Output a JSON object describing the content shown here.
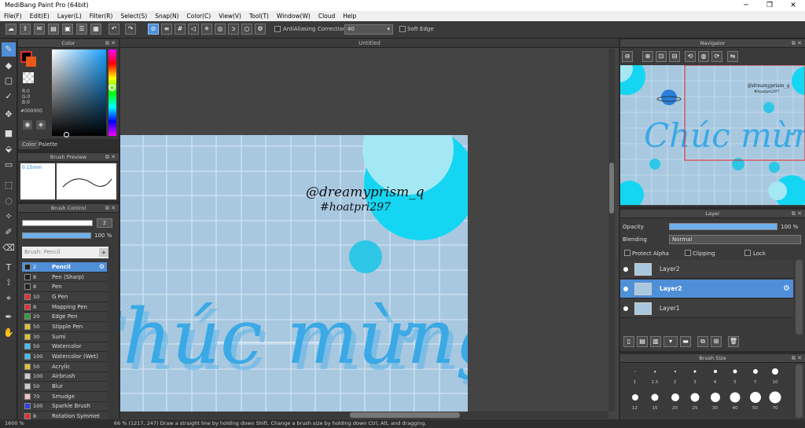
{
  "window": {
    "title": "MediBang Paint Pro (64bit)",
    "minimize": "─",
    "maximize": "❐",
    "close": "✕"
  },
  "menu": [
    "File(F)",
    "Edit(E)",
    "Layer(L)",
    "Filter(R)",
    "Select(S)",
    "Snap(N)",
    "Color(C)",
    "View(V)",
    "Tool(T)",
    "Window(W)",
    "Cloud",
    "Help"
  ],
  "toolbar": {
    "antialiasing_label": "AntiAliasing",
    "correction_label": "Correction",
    "correction_value": "40",
    "soft_edge_label": "Soft Edge"
  },
  "color_panel": {
    "title": "Color",
    "r": "R:0",
    "g": "G:0",
    "b": "B:0",
    "hex": "#000000",
    "tab_color": "Color",
    "tab_palette": "Palette",
    "primary_color": "#000000",
    "secondary_color": "#e85a1a"
  },
  "brush_preview": {
    "title": "Brush Preview",
    "size_label": "0.15mm"
  },
  "brush_control": {
    "title": "Brush Control",
    "size_value": "2",
    "opacity_value": "100 %",
    "brush_name": "Brush: Pencil"
  },
  "brushes": [
    {
      "size": "2",
      "name": "Pencil",
      "color": "#222222",
      "selected": true
    },
    {
      "size": "8",
      "name": "Pen (Sharp)",
      "color": "#222222"
    },
    {
      "size": "8",
      "name": "Pen",
      "color": "#222222"
    },
    {
      "size": "10",
      "name": "G Pen",
      "color": "#e03030"
    },
    {
      "size": "8",
      "name": "Mapping Pen",
      "color": "#e03030"
    },
    {
      "size": "20",
      "name": "Edge Pen",
      "color": "#30a030"
    },
    {
      "size": "50",
      "name": "Stipple Pen",
      "color": "#e0c030"
    },
    {
      "size": "30",
      "name": "Sumi",
      "color": "#e0c030"
    },
    {
      "size": "50",
      "name": "Watercolor",
      "color": "#40c0f0"
    },
    {
      "size": "100",
      "name": "Watercolor (Wet)",
      "color": "#40c0f0"
    },
    {
      "size": "50",
      "name": "Acrylic",
      "color": "#e0c030"
    },
    {
      "size": "100",
      "name": "Airbrush",
      "color": "#cccccc"
    },
    {
      "size": "50",
      "name": "Blur",
      "color": "#cccccc"
    },
    {
      "size": "70",
      "name": "Smudge",
      "color": "#f0c0c0"
    },
    {
      "size": "100",
      "name": "Sparkle Brush",
      "color": "#3040e0"
    },
    {
      "size": "8",
      "name": "Rotation Symmet",
      "color": "#e03030"
    }
  ],
  "document": {
    "tab_title": "Untitled",
    "signature_1": "@dreamyprism_q",
    "signature_2": "#hoatpri297",
    "title_text": "Chúc mừng"
  },
  "navigator": {
    "title": "Navigator"
  },
  "layer_panel": {
    "title": "Layer",
    "opacity_label": "Opacity",
    "opacity_value": "100 %",
    "blending_label": "Blending",
    "blending_value": "Normal",
    "protect_alpha": "Protect Alpha",
    "clipping": "Clipping",
    "lock": "Lock",
    "layers": [
      {
        "name": "Layer2"
      },
      {
        "name": "Layer2",
        "selected": true
      },
      {
        "name": "Layer1"
      }
    ]
  },
  "brush_size_panel": {
    "title": "Brush Size",
    "sizes": [
      "1",
      "1.5",
      "2",
      "3",
      "4",
      "5",
      "7",
      "10",
      "12",
      "15",
      "20",
      "25",
      "30",
      "40",
      "50",
      "70"
    ]
  },
  "status": {
    "zoom": "1600 %",
    "text": "66 %   (1217, 247)   Draw a straight line by holding down Shift. Change a brush size by holding down Ctrl, Alt, and dragging."
  }
}
